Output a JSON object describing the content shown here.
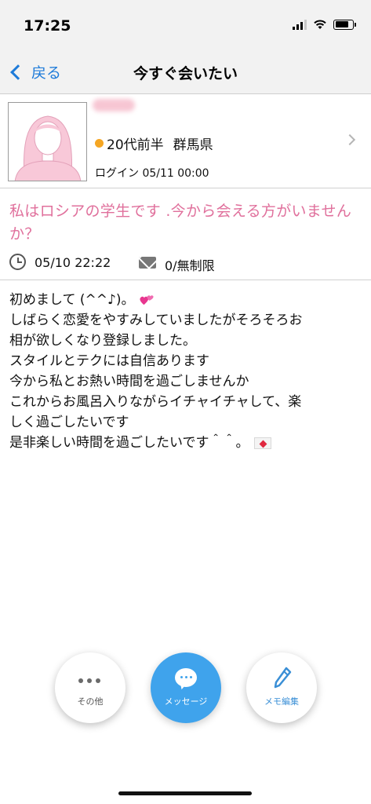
{
  "status_bar": {
    "time": "17:25"
  },
  "nav": {
    "back_label": "戻る",
    "title": "今すぐ会いたい"
  },
  "profile": {
    "age": "20代前半",
    "location": "群馬県",
    "login": "ログイン 05/11 00:00",
    "status_color": "#f5a623"
  },
  "post": {
    "title": "私はロシアの学生です .今から会える方がいませんか？",
    "date": "05/10 22:22",
    "replies": "0/無制限",
    "body": [
      "初めまして (^^♪)。",
      "しばらく恋愛をやすみしていましたがそろそろお",
      "相が欲しくなり登録しました。",
      "スタイルとテクには自信あります",
      "今から私とお熱い時間を過ごしませんか",
      "これからお風呂入りながらイチャイチャして、楽",
      "しく過ごしたいです",
      "是非楽しい時間を過ごしたいです＾＾。"
    ]
  },
  "actions": {
    "other_label": "その他",
    "message_label": "メッセージ",
    "memo_label": "メモ編集"
  },
  "colors": {
    "accent": "#3fa3ec",
    "title_pink": "#e0709c",
    "link_blue": "#1e7bd9"
  }
}
